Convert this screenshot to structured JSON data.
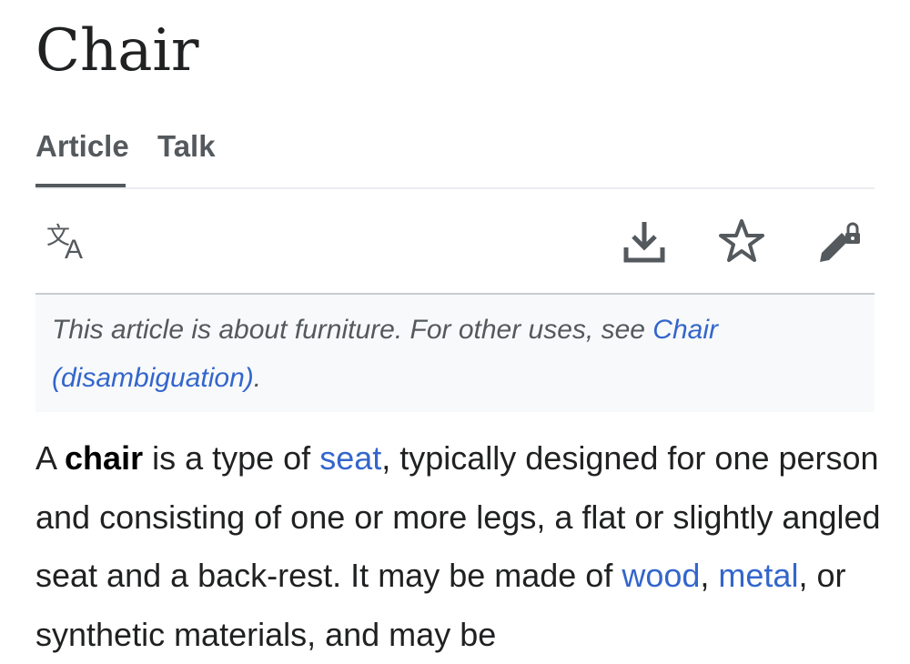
{
  "page": {
    "title": "Chair"
  },
  "tabs": [
    {
      "label": "Article",
      "selected": true
    },
    {
      "label": "Talk",
      "selected": false
    }
  ],
  "toolbar": {
    "left_icon": "language-translate-icon",
    "right_icons": [
      "download-icon",
      "star-icon",
      "edit-locked-icon"
    ]
  },
  "hatnote": {
    "prefix": "This article is about furniture. For other uses, see ",
    "link": "Chair (disambiguation)",
    "suffix": "."
  },
  "lead": {
    "t1": "A ",
    "bold": "chair",
    "t2": " is a type of ",
    "link_seat": "seat",
    "t3": ", typically designed for one person and consisting of one or more legs, a flat or slightly angled seat and a back-rest. It may be made of ",
    "link_wood": "wood",
    "t4": ", ",
    "link_metal": "metal",
    "t5": ", or synthetic materials, and may be"
  },
  "colors": {
    "link": "#3366cc",
    "text": "#202122",
    "muted": "#54595d",
    "hatnote_bg": "#f8f9fa"
  }
}
